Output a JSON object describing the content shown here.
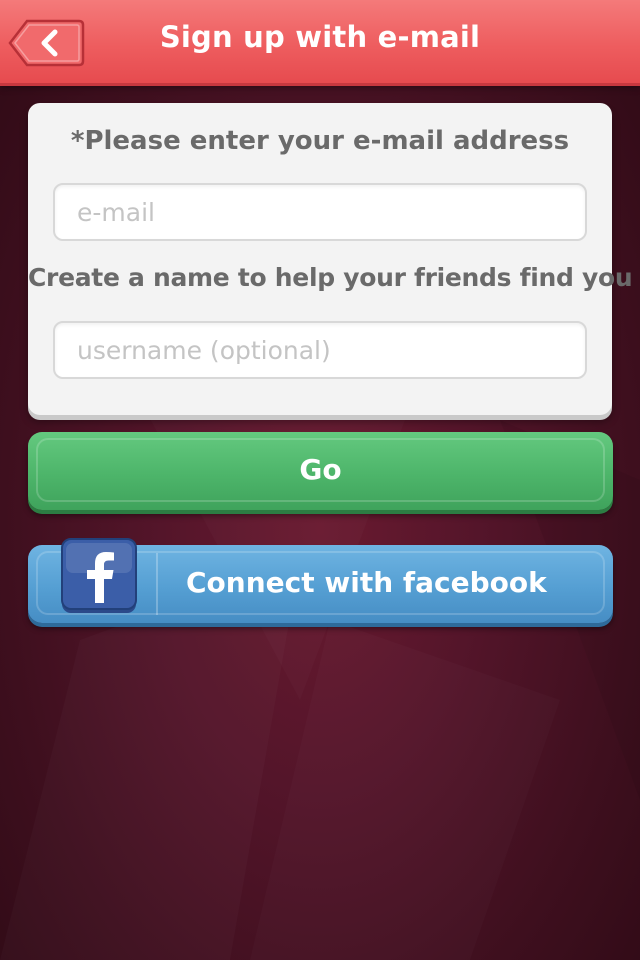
{
  "header": {
    "title": "Sign up with e-mail",
    "back_icon": "chevron-left-icon"
  },
  "form": {
    "email_label": "*Please enter your e-mail address",
    "email_placeholder": "e-mail",
    "email_value": "",
    "name_label": "Create a name to help your friends find you",
    "username_placeholder": "username (optional)",
    "username_value": ""
  },
  "actions": {
    "go_label": "Go",
    "facebook_label": "Connect with facebook",
    "facebook_icon": "facebook-logo-icon"
  },
  "colors": {
    "header": "#ee5d5f",
    "go_button": "#4db56a",
    "facebook_button": "#559fd3",
    "background": "#54152a"
  }
}
